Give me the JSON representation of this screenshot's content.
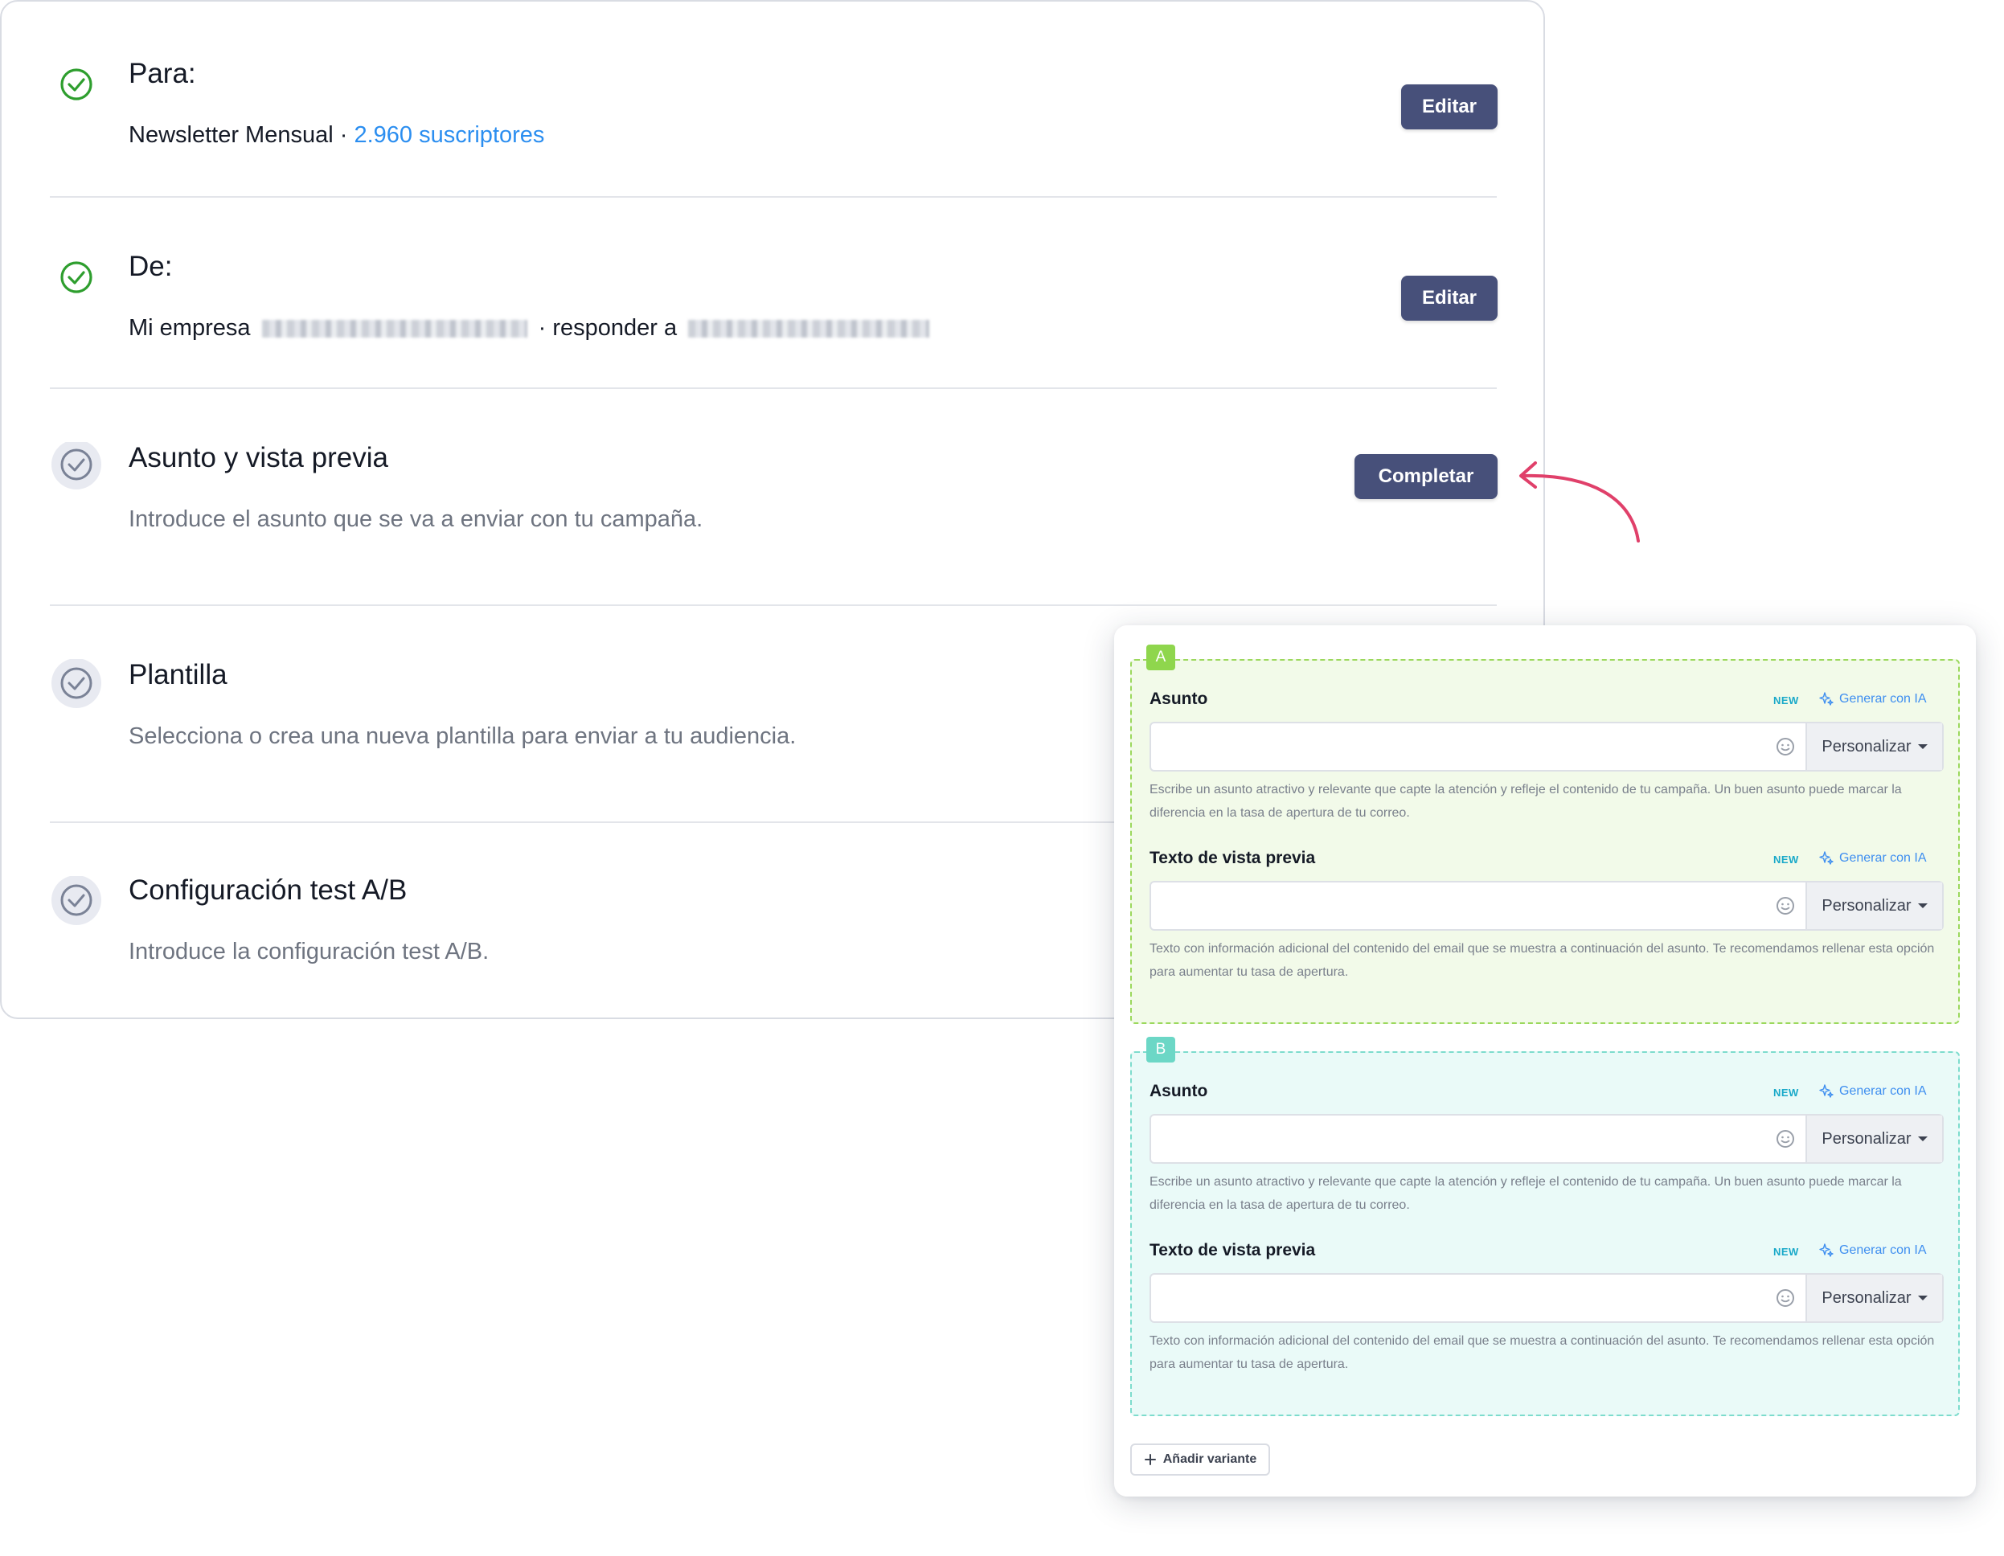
{
  "steps": [
    {
      "title": "Para:",
      "list_name": "Newsletter Mensual",
      "separator": "·",
      "subscribers": "2.960 suscriptores",
      "button": "Editar",
      "status": "complete"
    },
    {
      "title": "De:",
      "company": "Mi empresa",
      "separator": "·",
      "reply_to": "responder a",
      "button": "Editar",
      "status": "complete"
    },
    {
      "title": "Asunto y vista previa",
      "subtitle": "Introduce el asunto que se va a enviar con tu campaña.",
      "button": "Completar",
      "status": "pending"
    },
    {
      "title": "Plantilla",
      "subtitle": "Selecciona o crea una nueva plantilla para enviar a tu audiencia.",
      "status": "pending"
    },
    {
      "title": "Configuración test A/B",
      "subtitle": "Introduce la configuración test A/B.",
      "status": "pending"
    }
  ],
  "variants": [
    {
      "tag": "A",
      "subject_label": "Asunto",
      "preview_label": "Texto de vista previa",
      "new_badge": "NEW",
      "generate": "Generar con IA",
      "subject_value": "",
      "preview_value": "",
      "personalize": "Personalizar",
      "subject_help": "Escribe un asunto atractivo y relevante que capte la atención y refleje el contenido de tu campaña. Un buen asunto puede marcar la diferencia en la tasa de apertura de tu correo.",
      "preview_help": "Texto con información adicional del contenido del email que se muestra a continuación del asunto. Te recomendamos rellenar esta opción para aumentar tu tasa de apertura."
    },
    {
      "tag": "B",
      "subject_label": "Asunto",
      "preview_label": "Texto de vista previa",
      "new_badge": "NEW",
      "generate": "Generar con IA",
      "subject_value": "",
      "preview_value": "",
      "personalize": "Personalizar",
      "subject_help": "Escribe un asunto atractivo y relevante que capte la atención y refleje el contenido de tu campaña. Un buen asunto puede marcar la diferencia en la tasa de apertura de tu correo.",
      "preview_help": "Texto con información adicional del contenido del email que se muestra a continuación del asunto. Te recomendamos rellenar esta opción para aumentar tu tasa de apertura."
    }
  ],
  "add_variant": "Añadir variante",
  "colors": {
    "button": "#47507a",
    "link": "#2b8ef0",
    "success": "#2e9e2e",
    "pending": "#7a8296",
    "arrow": "#e0406a",
    "variant_a_bg": "#f2fae9",
    "variant_b_bg": "#eafaf8"
  }
}
